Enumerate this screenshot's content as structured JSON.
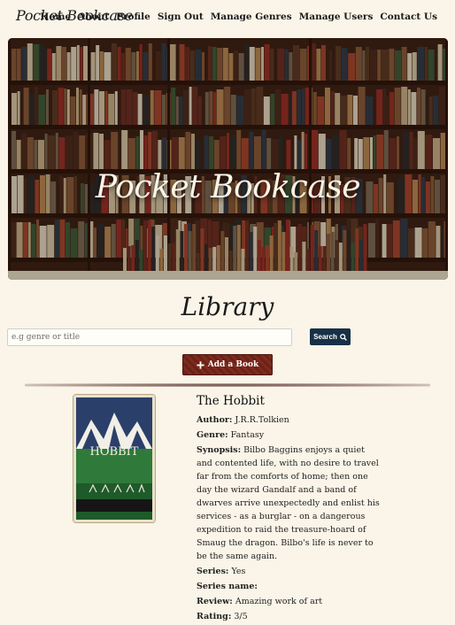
{
  "nav": {
    "brand": "Pocket Bookcase",
    "links": [
      "Home",
      "About",
      "Profile",
      "Sign Out",
      "Manage Genres",
      "Manage Users",
      "Contact Us"
    ]
  },
  "hero": {
    "title": "Pocket Bookcase"
  },
  "library": {
    "title": "Library",
    "search": {
      "placeholder": "e.g genre or title",
      "button": "Search"
    },
    "add_button": "Add a Book"
  },
  "book": {
    "title": "The Hobbit",
    "author_label": "Author:",
    "author": "J.R.R.Tolkien",
    "genre_label": "Genre:",
    "genre": "Fantasy",
    "synopsis_label": "Synopsis:",
    "synopsis": "Bilbo Baggins enjoys a quiet and contented life, with no desire to travel far from the comforts of home; then one day the wizard Gandalf and a band of dwarves arrive unexpectedly and enlist his services - as a burglar - on a dangerous expedition to raid the treasure-hoard of Smaug the dragon. Bilbo's life is never to be the same again.",
    "series_label": "Series:",
    "series": "Yes",
    "series_name_label": "Series name:",
    "series_name": "",
    "review_label": "Review:",
    "review": "Amazing work of art",
    "rating_label": "Rating:",
    "rating": "3/5",
    "cover_text": "HOBBIT"
  },
  "colors": {
    "background": "#faf5e8",
    "search_button": "#173047",
    "add_button": "#7d2a1d"
  },
  "icons": {
    "search": "search-icon",
    "add": "plus-icon"
  }
}
